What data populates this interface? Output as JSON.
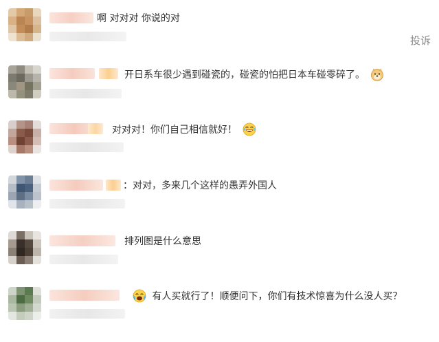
{
  "report_label": "投诉",
  "comments": [
    {
      "text": "啊 对对对 你说的对",
      "emoji": null
    },
    {
      "text": "开日系车很少遇到碰瓷的，碰瓷的怕把日本车碰零碎了。",
      "emoji": "doge-icon"
    },
    {
      "text": "对对对！你们自己相信就好！",
      "emoji": "laughing-icon"
    },
    {
      "text": "：对对，多来几个这样的愚弄外国人",
      "emoji": null
    },
    {
      "text": "排列图是什么意思",
      "emoji": null
    },
    {
      "text": "有人买就行了！顺便问下，你们有技术惊喜为什么没人买？",
      "emoji": "crying-laughing-icon"
    }
  ],
  "colors": {
    "text": "#333333",
    "report": "#888888",
    "blur_name": "#f8d6cc",
    "blur_meta": "#eeeeee"
  }
}
